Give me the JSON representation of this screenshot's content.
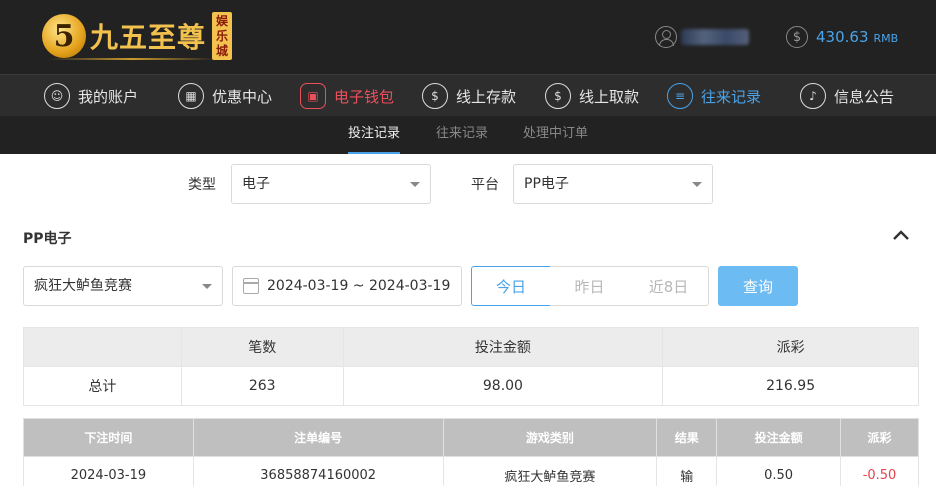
{
  "brand": {
    "badge": "5",
    "name": "九五至尊",
    "seal": [
      "娱",
      "乐",
      "城"
    ]
  },
  "account": {
    "balance": "430.63",
    "currency": "RMB"
  },
  "nav": [
    {
      "label": "我的账户",
      "icon": "user-icon"
    },
    {
      "label": "优惠中心",
      "icon": "gift-icon"
    },
    {
      "label": "电子钱包",
      "icon": "wallet-icon"
    },
    {
      "label": "线上存款",
      "icon": "deposit-icon"
    },
    {
      "label": "线上取款",
      "icon": "withdraw-icon"
    },
    {
      "label": "往来记录",
      "icon": "records-icon"
    },
    {
      "label": "信息公告",
      "icon": "bell-icon"
    }
  ],
  "subtabs": [
    "投注记录",
    "往来记录",
    "处理中订单"
  ],
  "filters": {
    "type_label": "类型",
    "type_value": "电子",
    "platform_label": "平台",
    "platform_value": "PP电子"
  },
  "section_title": "PP电子",
  "game_select": "疯狂大鲈鱼竞赛",
  "date_range": "2024-03-19 ~ 2024-03-19",
  "quick_ranges": [
    "今日",
    "昨日",
    "近8日"
  ],
  "query_button": "查询",
  "summary": {
    "headers": [
      "",
      "笔数",
      "投注金额",
      "派彩"
    ],
    "row": [
      "总计",
      "263",
      "98.00",
      "216.95"
    ]
  },
  "records": {
    "headers": [
      "下注时间",
      "注单编号",
      "游戏类别",
      "结果",
      "投注金额",
      "派彩"
    ],
    "rows": [
      [
        "2024-03-19",
        "36858874160002",
        "疯狂大鲈鱼竞赛",
        "输",
        "0.50",
        "-0.50"
      ]
    ]
  },
  "colors": {
    "accent_blue": "#4aa3e8",
    "accent_red": "#ec4f5c",
    "negative": "#e2454f",
    "brand_gold": "#f2c14e"
  }
}
